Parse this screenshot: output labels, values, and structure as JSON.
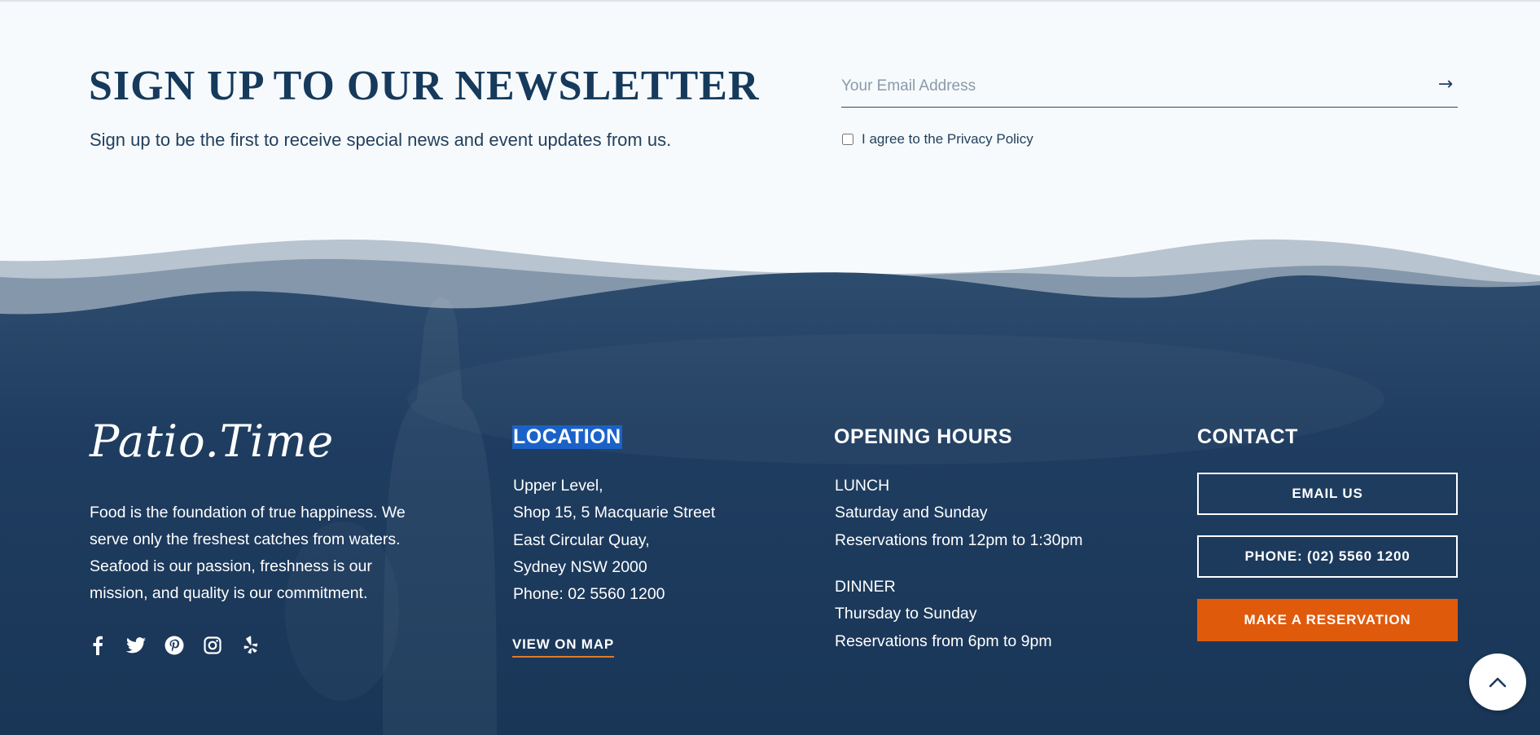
{
  "newsletter": {
    "title": "SIGN UP TO OUR NEWSLETTER",
    "subtitle": "Sign up to be the first to receive special news and event updates from us.",
    "email_placeholder": "Your Email Address",
    "submit_icon": "arrow-right-icon",
    "agree_prefix": "I agree to the ",
    "agree_link": "Privacy Policy"
  },
  "brand": {
    "logo": "Patio.Time",
    "about": "Food is the foundation of true happiness. We serve only the freshest catches from waters. Seafood is our passion, freshness is our mission, and quality is our commitment."
  },
  "social": [
    "facebook-icon",
    "twitter-icon",
    "pinterest-icon",
    "instagram-icon",
    "yelp-icon"
  ],
  "location": {
    "heading": "LOCATION",
    "lines": [
      "Upper Level,",
      "Shop 15, 5 Macquarie Street",
      "East Circular Quay,",
      "Sydney NSW 2000",
      "Phone: 02 5560 1200"
    ],
    "map_link": "VIEW ON MAP"
  },
  "hours": {
    "heading": "OPENING HOURS",
    "lunch": {
      "label": "LUNCH",
      "days": "Saturday and Sunday",
      "times": "Reservations from 12pm to 1:30pm"
    },
    "dinner": {
      "label": "DINNER",
      "days": "Thursday to Sunday",
      "times": "Reservations from 6pm to 9pm"
    }
  },
  "contact": {
    "heading": "CONTACT",
    "email_btn": "EMAIL US",
    "phone_btn": "PHONE: (02) 5560 1200",
    "reserve_btn": "MAKE A RESERVATION"
  },
  "colors": {
    "navy": "#1c3a5e",
    "accent_orange": "#e05a0c",
    "selection": "#1a62c8"
  },
  "back_to_top_icon": "chevron-up-icon"
}
